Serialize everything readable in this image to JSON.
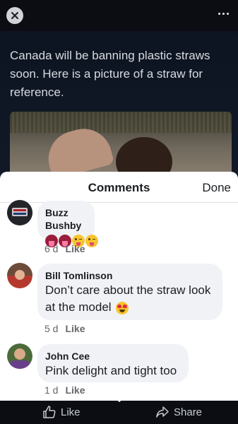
{
  "post": {
    "text": "Canada will be banning plastic straws soon. Here is a picture of a straw for reference."
  },
  "icons": {
    "close": "close-icon",
    "more": "more-icon",
    "like": "thumbs-up-icon",
    "share": "share-arrow-icon"
  },
  "sheet": {
    "title": "Comments",
    "done_label": "Done"
  },
  "comments": [
    {
      "author": "Buzz Bushby",
      "text": "",
      "reactions": [
        "tongue-emoji",
        "tongue-emoji",
        "winking-tongue-emoji",
        "winking-tongue-emoji"
      ],
      "time": "6 d",
      "like_label": "Like"
    },
    {
      "author": "Bill Tomlinson",
      "text": "Don’t care about the straw look at the model",
      "reactions": [
        "heart-eyes-emoji"
      ],
      "time": "5 d",
      "like_label": "Like"
    },
    {
      "author": "John Cee",
      "text": "Pink delight and tight too",
      "time": "1 d",
      "like_label": "Like"
    }
  ],
  "actions": {
    "like_label": "Like",
    "share_label": "Share"
  },
  "colors": {
    "bubble": "#f0f2f5",
    "meta_text": "#65676b",
    "dark_bg": "#0c1320"
  }
}
